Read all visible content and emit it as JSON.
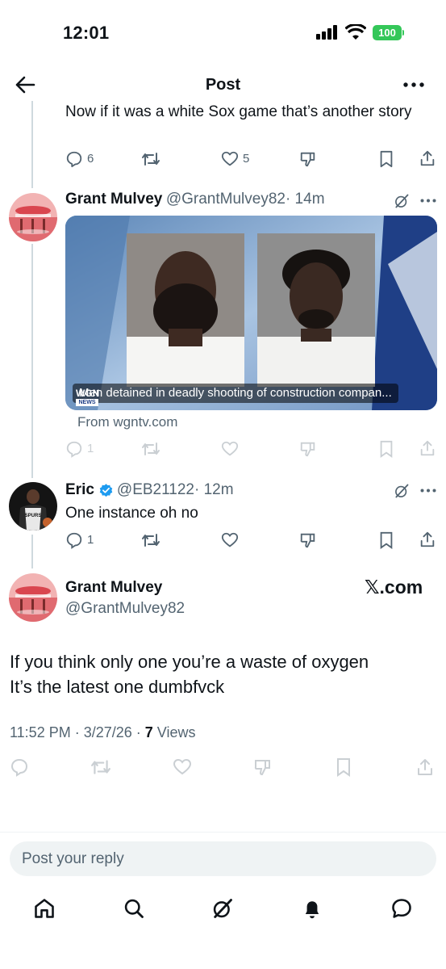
{
  "status_bar": {
    "time": "12:01",
    "battery": "100"
  },
  "header": {
    "title": "Post"
  },
  "prev_tweet": {
    "text": "Now if it was a white Sox game that’s another story",
    "replies": "6",
    "likes": "5"
  },
  "tweet1": {
    "name": "Grant Mulvey",
    "handle": "@GrantMulvey82",
    "time": "· 14m",
    "card_caption": "Men detained in deadly shooting of construction compan...",
    "card_logo": "WGN",
    "card_logo_sub": "NEWS",
    "card_source": "From wgntv.com",
    "replies": "1"
  },
  "tweet2": {
    "name": "Eric",
    "handle": "@EB21122",
    "time": "· 12m",
    "text": "One instance oh no",
    "replies": "1",
    "jersey": "SPURS"
  },
  "main_tweet": {
    "name": "Grant Mulvey",
    "handle": "@GrantMulvey82",
    "watermark": "𝕏.com",
    "line1": "If you think only one you’re a waste of oxygen",
    "line2": "It’s the latest one dumbfvck",
    "timestamp": "11:52 PM · 3/27/26 · ",
    "views_count": "7",
    "views_label": " Views"
  },
  "reply": {
    "placeholder": "Post your reply"
  },
  "colors": {
    "verified": "#1d9bf0",
    "battery": "#34c759",
    "gray": "#536471"
  },
  "icons": [
    "back-arrow-icon",
    "more-icon",
    "reply-icon",
    "retweet-icon",
    "like-icon",
    "dislike-icon",
    "bookmark-icon",
    "share-icon",
    "grok-icon",
    "home-icon",
    "search-icon",
    "bell-icon",
    "messages-icon"
  ]
}
